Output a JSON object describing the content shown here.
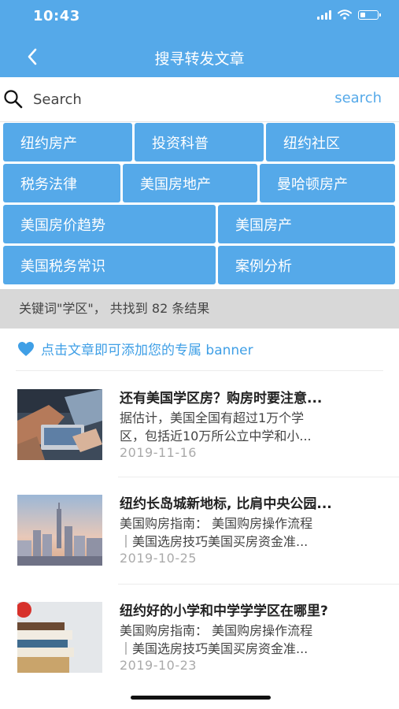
{
  "status": {
    "time": "10:43"
  },
  "header": {
    "title": "搜寻转发文章"
  },
  "search": {
    "placeholder": "Search",
    "button": "search"
  },
  "tags": {
    "rows": [
      [
        "纽约房产",
        "投资科普",
        "纽约社区"
      ],
      [
        "税务法律",
        "美国房地产",
        "曼哈顿房产"
      ],
      [
        "美国房价趋势",
        "美国房产"
      ],
      [
        "美国税务常识",
        "案例分析"
      ]
    ]
  },
  "result": {
    "text": "关键词\"学区\"， 共找到 82 条结果"
  },
  "banner_tip": {
    "text": "点击文章即可添加您的专属 banner"
  },
  "articles": [
    {
      "title": "还有美国学区房？购房时要注意...",
      "desc1": "据估计，美国全国有超过1万个学",
      "desc2": "区，包括近10万所公立中学和小...",
      "date": "2019-11-16"
    },
    {
      "title": "纽约长岛城新地标, 比肩中央公园...",
      "desc1": "美国购房指南： 美国购房操作流程",
      "desc2": "｜美国选房技巧美国买房资金准...",
      "date": "2019-10-25"
    },
    {
      "title": "纽约好的小学和中学学学区在哪里?",
      "desc1": "美国购房指南： 美国购房操作流程",
      "desc2": "｜美国选房技巧美国买房资金准...",
      "date": "2019-10-23"
    }
  ],
  "colors": {
    "accent": "#55a9e9",
    "result_bar": "#d8d8d8"
  },
  "icons": [
    "back-chevron-icon",
    "search-icon",
    "heart-icon",
    "signal-icon",
    "wifi-icon",
    "battery-icon"
  ]
}
